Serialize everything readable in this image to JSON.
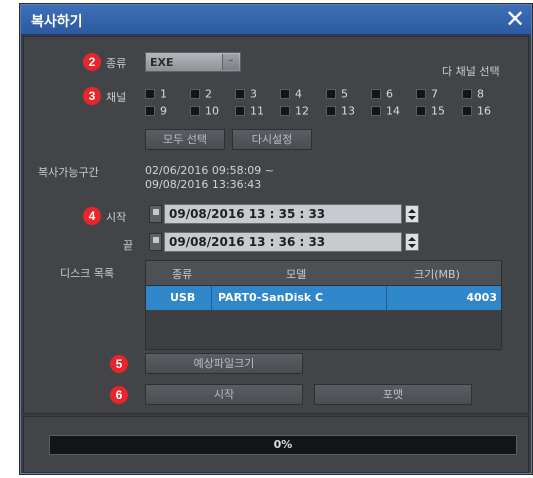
{
  "window": {
    "title": "복사하기",
    "close_icon": "✕"
  },
  "markers": [
    "2",
    "3",
    "4",
    "5",
    "6"
  ],
  "type_field": {
    "label": "종류",
    "value": "EXE",
    "arrow": "–"
  },
  "multi_channel_label": "다 채널 선택",
  "channel_field": {
    "label": "채널",
    "channels": [
      "1",
      "2",
      "3",
      "4",
      "5",
      "6",
      "7",
      "8",
      "9",
      "10",
      "11",
      "12",
      "13",
      "14",
      "15",
      "16"
    ]
  },
  "buttons": {
    "select_all": "모두 선택",
    "reset": "다시설정",
    "estimate_size": "예상파일크기",
    "start": "시작",
    "format": "포맷"
  },
  "copy_range": {
    "label": "복사가능구간",
    "start": "02/06/2016  09:58:09 ~",
    "end": "09/08/2016  13:36:43"
  },
  "start_time": {
    "label": "시작",
    "value": "09/08/2016  13 : 35 : 33"
  },
  "end_time": {
    "label": "끝",
    "value": "09/08/2016  13 : 36 : 33"
  },
  "disk_list": {
    "label": "디스크 목록",
    "headers": [
      "종류",
      "모델",
      "크기(MB)"
    ],
    "rows": [
      {
        "type": "USB",
        "model": "PART0-SanDisk C",
        "size": "4003"
      }
    ]
  },
  "progress": {
    "text": "0%",
    "value": 0
  },
  "colors": {
    "titlebar": "#2f5fa8",
    "marker": "#e8252a",
    "selected_row": "#2f86c9"
  }
}
